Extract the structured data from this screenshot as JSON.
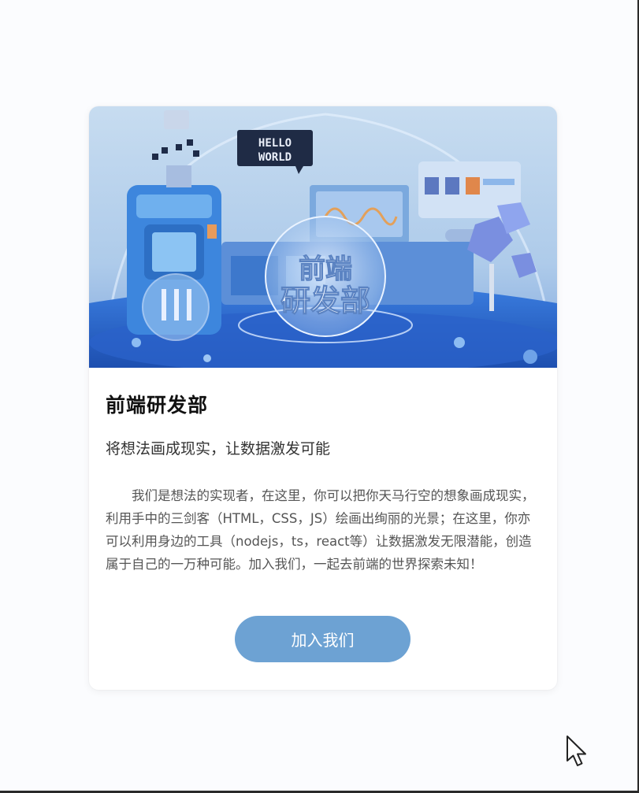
{
  "card": {
    "banner": {
      "hello_sign": [
        "HELLO",
        "WORLD"
      ],
      "globe_text": [
        "前端",
        "研发部"
      ]
    },
    "title": "前端研发部",
    "subtitle": "将想法画成现实，让数据激发可能",
    "description": "我们是想法的实现者，在这里，你可以把你天马行空的想象画成现实，利用手中的三剑客（HTML，CSS，JS）绘画出绚丽的光景；在这里，你亦可以利用身边的工具（nodejs，ts，react等）让数据激发无限潜能，创造属于自己的一万种可能。加入我们，一起去前端的世界探索未知！",
    "button_label": "加入我们"
  },
  "colors": {
    "button": "#6da2d3",
    "banner_sky": "#bcd6ef",
    "banner_blue": "#2f6fd0"
  },
  "icons": {
    "cursor": "mouse-pointer-icon"
  }
}
